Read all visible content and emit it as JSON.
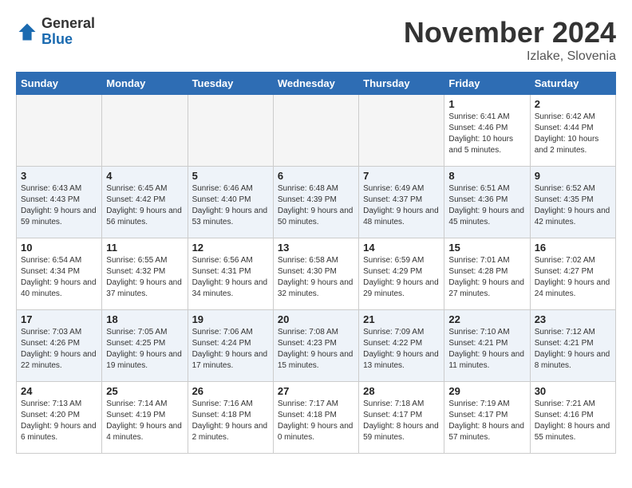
{
  "header": {
    "logo_general": "General",
    "logo_blue": "Blue",
    "month_title": "November 2024",
    "location": "Izlake, Slovenia"
  },
  "weekdays": [
    "Sunday",
    "Monday",
    "Tuesday",
    "Wednesday",
    "Thursday",
    "Friday",
    "Saturday"
  ],
  "weeks": [
    [
      {
        "day": "",
        "sunrise": "",
        "sunset": "",
        "daylight": ""
      },
      {
        "day": "",
        "sunrise": "",
        "sunset": "",
        "daylight": ""
      },
      {
        "day": "",
        "sunrise": "",
        "sunset": "",
        "daylight": ""
      },
      {
        "day": "",
        "sunrise": "",
        "sunset": "",
        "daylight": ""
      },
      {
        "day": "",
        "sunrise": "",
        "sunset": "",
        "daylight": ""
      },
      {
        "day": "1",
        "sunrise": "Sunrise: 6:41 AM",
        "sunset": "Sunset: 4:46 PM",
        "daylight": "Daylight: 10 hours and 5 minutes."
      },
      {
        "day": "2",
        "sunrise": "Sunrise: 6:42 AM",
        "sunset": "Sunset: 4:44 PM",
        "daylight": "Daylight: 10 hours and 2 minutes."
      }
    ],
    [
      {
        "day": "3",
        "sunrise": "Sunrise: 6:43 AM",
        "sunset": "Sunset: 4:43 PM",
        "daylight": "Daylight: 9 hours and 59 minutes."
      },
      {
        "day": "4",
        "sunrise": "Sunrise: 6:45 AM",
        "sunset": "Sunset: 4:42 PM",
        "daylight": "Daylight: 9 hours and 56 minutes."
      },
      {
        "day": "5",
        "sunrise": "Sunrise: 6:46 AM",
        "sunset": "Sunset: 4:40 PM",
        "daylight": "Daylight: 9 hours and 53 minutes."
      },
      {
        "day": "6",
        "sunrise": "Sunrise: 6:48 AM",
        "sunset": "Sunset: 4:39 PM",
        "daylight": "Daylight: 9 hours and 50 minutes."
      },
      {
        "day": "7",
        "sunrise": "Sunrise: 6:49 AM",
        "sunset": "Sunset: 4:37 PM",
        "daylight": "Daylight: 9 hours and 48 minutes."
      },
      {
        "day": "8",
        "sunrise": "Sunrise: 6:51 AM",
        "sunset": "Sunset: 4:36 PM",
        "daylight": "Daylight: 9 hours and 45 minutes."
      },
      {
        "day": "9",
        "sunrise": "Sunrise: 6:52 AM",
        "sunset": "Sunset: 4:35 PM",
        "daylight": "Daylight: 9 hours and 42 minutes."
      }
    ],
    [
      {
        "day": "10",
        "sunrise": "Sunrise: 6:54 AM",
        "sunset": "Sunset: 4:34 PM",
        "daylight": "Daylight: 9 hours and 40 minutes."
      },
      {
        "day": "11",
        "sunrise": "Sunrise: 6:55 AM",
        "sunset": "Sunset: 4:32 PM",
        "daylight": "Daylight: 9 hours and 37 minutes."
      },
      {
        "day": "12",
        "sunrise": "Sunrise: 6:56 AM",
        "sunset": "Sunset: 4:31 PM",
        "daylight": "Daylight: 9 hours and 34 minutes."
      },
      {
        "day": "13",
        "sunrise": "Sunrise: 6:58 AM",
        "sunset": "Sunset: 4:30 PM",
        "daylight": "Daylight: 9 hours and 32 minutes."
      },
      {
        "day": "14",
        "sunrise": "Sunrise: 6:59 AM",
        "sunset": "Sunset: 4:29 PM",
        "daylight": "Daylight: 9 hours and 29 minutes."
      },
      {
        "day": "15",
        "sunrise": "Sunrise: 7:01 AM",
        "sunset": "Sunset: 4:28 PM",
        "daylight": "Daylight: 9 hours and 27 minutes."
      },
      {
        "day": "16",
        "sunrise": "Sunrise: 7:02 AM",
        "sunset": "Sunset: 4:27 PM",
        "daylight": "Daylight: 9 hours and 24 minutes."
      }
    ],
    [
      {
        "day": "17",
        "sunrise": "Sunrise: 7:03 AM",
        "sunset": "Sunset: 4:26 PM",
        "daylight": "Daylight: 9 hours and 22 minutes."
      },
      {
        "day": "18",
        "sunrise": "Sunrise: 7:05 AM",
        "sunset": "Sunset: 4:25 PM",
        "daylight": "Daylight: 9 hours and 19 minutes."
      },
      {
        "day": "19",
        "sunrise": "Sunrise: 7:06 AM",
        "sunset": "Sunset: 4:24 PM",
        "daylight": "Daylight: 9 hours and 17 minutes."
      },
      {
        "day": "20",
        "sunrise": "Sunrise: 7:08 AM",
        "sunset": "Sunset: 4:23 PM",
        "daylight": "Daylight: 9 hours and 15 minutes."
      },
      {
        "day": "21",
        "sunrise": "Sunrise: 7:09 AM",
        "sunset": "Sunset: 4:22 PM",
        "daylight": "Daylight: 9 hours and 13 minutes."
      },
      {
        "day": "22",
        "sunrise": "Sunrise: 7:10 AM",
        "sunset": "Sunset: 4:21 PM",
        "daylight": "Daylight: 9 hours and 11 minutes."
      },
      {
        "day": "23",
        "sunrise": "Sunrise: 7:12 AM",
        "sunset": "Sunset: 4:21 PM",
        "daylight": "Daylight: 9 hours and 8 minutes."
      }
    ],
    [
      {
        "day": "24",
        "sunrise": "Sunrise: 7:13 AM",
        "sunset": "Sunset: 4:20 PM",
        "daylight": "Daylight: 9 hours and 6 minutes."
      },
      {
        "day": "25",
        "sunrise": "Sunrise: 7:14 AM",
        "sunset": "Sunset: 4:19 PM",
        "daylight": "Daylight: 9 hours and 4 minutes."
      },
      {
        "day": "26",
        "sunrise": "Sunrise: 7:16 AM",
        "sunset": "Sunset: 4:18 PM",
        "daylight": "Daylight: 9 hours and 2 minutes."
      },
      {
        "day": "27",
        "sunrise": "Sunrise: 7:17 AM",
        "sunset": "Sunset: 4:18 PM",
        "daylight": "Daylight: 9 hours and 0 minutes."
      },
      {
        "day": "28",
        "sunrise": "Sunrise: 7:18 AM",
        "sunset": "Sunset: 4:17 PM",
        "daylight": "Daylight: 8 hours and 59 minutes."
      },
      {
        "day": "29",
        "sunrise": "Sunrise: 7:19 AM",
        "sunset": "Sunset: 4:17 PM",
        "daylight": "Daylight: 8 hours and 57 minutes."
      },
      {
        "day": "30",
        "sunrise": "Sunrise: 7:21 AM",
        "sunset": "Sunset: 4:16 PM",
        "daylight": "Daylight: 8 hours and 55 minutes."
      }
    ]
  ]
}
